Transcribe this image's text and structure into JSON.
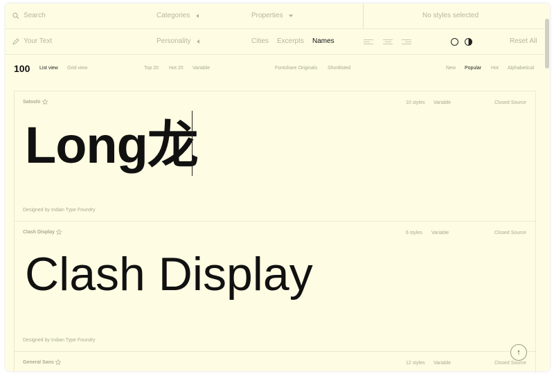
{
  "toolbar": {
    "search_placeholder": "Search",
    "categories_label": "Categories",
    "properties_label": "Properties",
    "no_styles_label": "No styles selected",
    "your_text_placeholder": "Your Text",
    "personality_label": "Personality",
    "text_modes": [
      "Cities",
      "Excerpts",
      "Names"
    ],
    "active_text_mode": "Names",
    "reset_label": "Reset All"
  },
  "viewbar": {
    "count": "100",
    "list_view": "List view",
    "grid_view": "Grid view",
    "filters": [
      "Top 20",
      "Hot 20",
      "Variable"
    ],
    "collections": [
      "Fontshare Originals",
      "Shortlisted"
    ],
    "sort": [
      "New",
      "Popular",
      "Hot",
      "Alphabetical"
    ],
    "active_sort": "Popular"
  },
  "fonts": [
    {
      "name": "Satoshi",
      "styles": "10 styles",
      "variable": "Variable",
      "license": "Closed Source",
      "sample": "Long龙",
      "designer": "Designed by Indian Type Foundry"
    },
    {
      "name": "Clash Display",
      "styles": "6 styles",
      "variable": "Variable",
      "license": "Closed Source",
      "sample": "Clash Display",
      "designer": "Designed by Indian Type Foundry"
    },
    {
      "name": "General Sans",
      "styles": "12 styles",
      "variable": "Variable",
      "license": "Closed Source"
    }
  ],
  "scroll_top_icon": "arrow-up-icon",
  "colors": {
    "background": "#fefde3",
    "muted": "#b6b59e",
    "text": "#111111"
  }
}
